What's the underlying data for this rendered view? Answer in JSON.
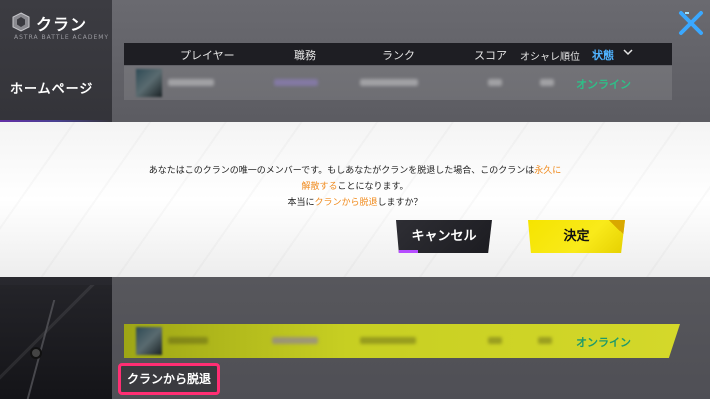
{
  "header": {
    "title": "クラン",
    "subtitle": "ASTRA BATTLE ACADEMY"
  },
  "sidebar": {
    "home_label": "ホームページ"
  },
  "table": {
    "columns": [
      "プレイヤー",
      "職務",
      "ランク",
      "スコア",
      "オシャレ順位",
      "状態"
    ],
    "sort_icon": "chevron-down-icon",
    "rows": [
      {
        "status": "オンライン"
      },
      {
        "status": "オンライン"
      }
    ]
  },
  "dialog": {
    "line1_a": "あなたはこのクランの唯一のメンバーです。もしあなたがクランを脱退した場合、このクランは",
    "line1_hl": "永久に",
    "line2_hl": "解散する",
    "line2_b": "ことになります。",
    "line3_a": "本当に",
    "line3_hl": "クランから脱退",
    "line3_b": "しますか？",
    "cancel_label": "キャンセル",
    "confirm_label": "決定"
  },
  "footer": {
    "leave_label": "クランから脱退"
  },
  "colors": {
    "accent_yellow": "#f5e400",
    "highlight_orange": "#f08a1c",
    "online_green": "#2fbf88",
    "sort_blue": "#4fb3ff",
    "close_blue": "#3aa8ff",
    "leave_border": "#ff2e73"
  }
}
